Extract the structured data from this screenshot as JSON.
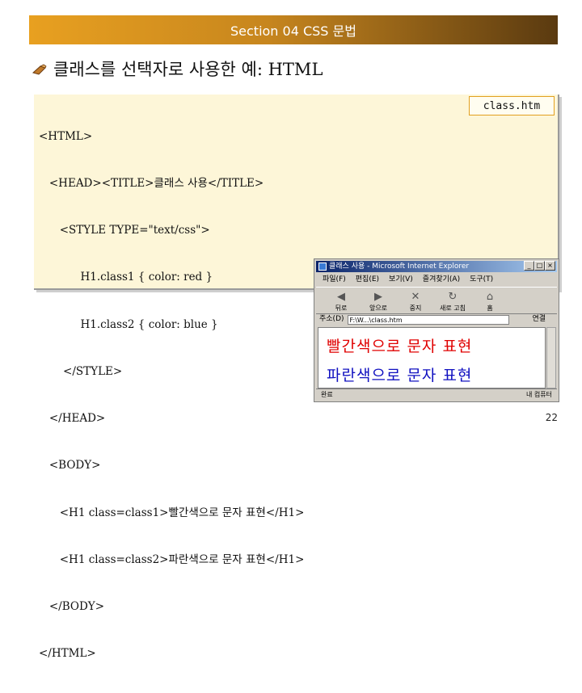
{
  "header": {
    "title": "Section 04 CSS 문법"
  },
  "heading": {
    "text": "클래스를 선택자로 사용한 예: HTML"
  },
  "code_panel": {
    "filename": "class.htm",
    "lines": [
      "<HTML>",
      "   <HEAD><TITLE>클래스 사용</TITLE>",
      "      <STYLE TYPE=\"text/css\">",
      "            H1.class1 { color: red }",
      "            H1.class2 { color: blue }",
      "       </STYLE>",
      "   </HEAD>",
      "   <BODY>",
      "      <H1 class=class1>빨간색으로 문자 표현</H1>",
      "      <H1 class=class2>파란색으로 문자 표현</H1>",
      "   </BODY>",
      "</HTML>"
    ]
  },
  "browser": {
    "title": "클래스 사용 - Microsoft Internet Explorer",
    "menu": [
      "파일(F)",
      "편집(E)",
      "보기(V)",
      "즐겨찾기(A)",
      "도구(T)"
    ],
    "toolbar": [
      "뒤로",
      "앞으로",
      "중지",
      "새로 고침",
      "홈"
    ],
    "address_label": "주소(D)",
    "address_value": "F:\\W...\\class.htm",
    "address_links": "연결",
    "content": {
      "line_red": "빨간색으로 문자 표현",
      "line_blue": "파란색으로 문자 표현"
    },
    "status_left": "완료",
    "status_right": "내 컴퓨터",
    "colors": {
      "red": "#e00000",
      "blue": "#1010c0"
    }
  },
  "page_number": "22"
}
